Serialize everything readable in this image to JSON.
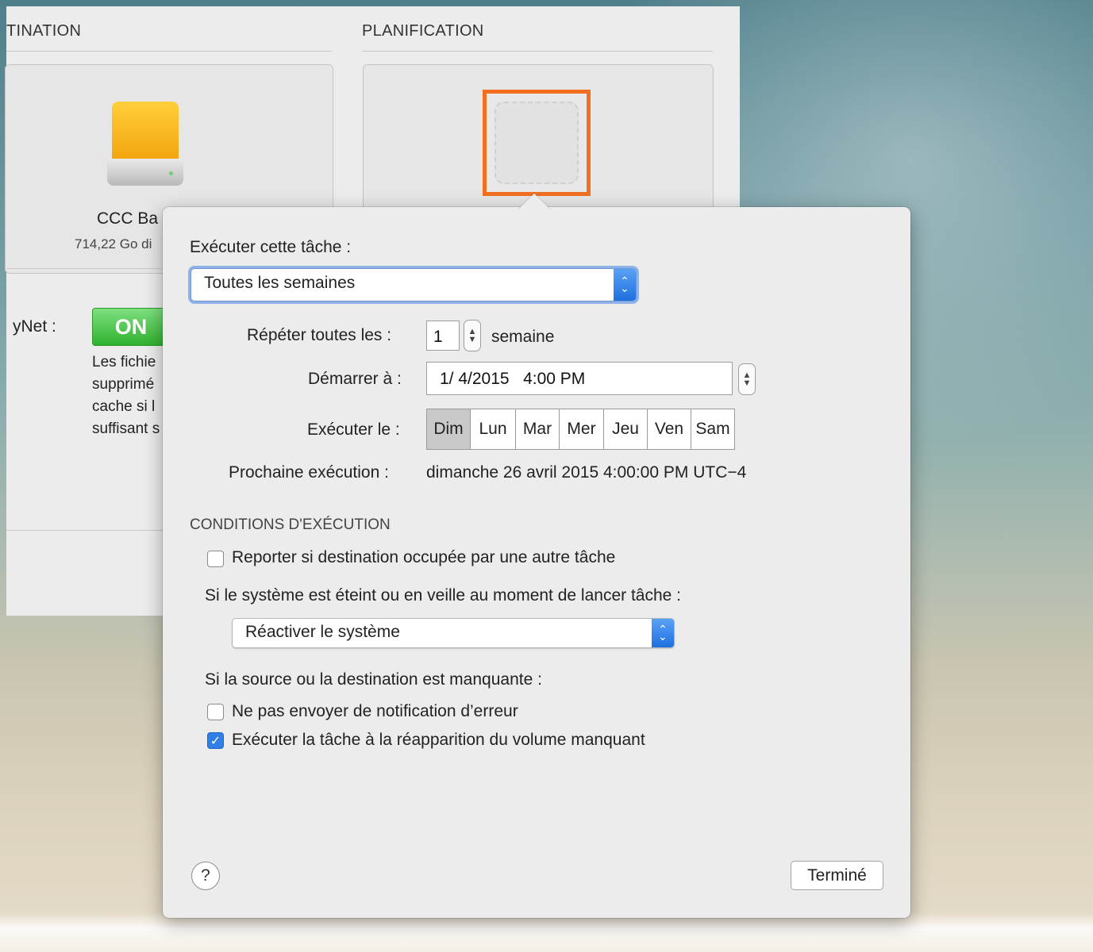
{
  "background": {
    "left_sections": {
      "destination_header": "TINATION",
      "planning_header": "PLANIFICATION"
    },
    "drive": {
      "name": "CCC Ba",
      "size": "714,22 Go di"
    },
    "safetynet": {
      "label": "yNet :",
      "toggle": "ON",
      "text_lines": [
        "Les fichie",
        "supprimé",
        "cache si l",
        "suffisant s"
      ]
    }
  },
  "popover": {
    "run_task_label": "Exécuter cette tâche :",
    "frequency_value": "Toutes les semaines",
    "repeat_label": "Répéter toutes les :",
    "repeat_value": "1",
    "repeat_unit": "semaine",
    "start_label": "Démarrer à :",
    "start_value": "1/ 4/2015   4:00 PM",
    "run_on_label": "Exécuter le :",
    "days": [
      "Dim",
      "Lun",
      "Mar",
      "Mer",
      "Jeu",
      "Ven",
      "Sam"
    ],
    "selected_day": "Dim",
    "next_run_label": "Prochaine exécution :",
    "next_run_value": "dimanche 26 avril 2015 4:00:00 PM UTC−4",
    "conditions_header": "CONDITIONS D'EXÉCUTION",
    "defer_checkbox_label": "Reporter si destination occupée par une autre tâche",
    "defer_checked": false,
    "system_off_label": "Si le système est éteint ou en veille au moment de lancer tâche :",
    "system_off_value": "Réactiver le système",
    "missing_label": "Si la source ou la destination est manquante :",
    "no_notify_label": "Ne pas envoyer de notification d’erreur",
    "no_notify_checked": false,
    "run_on_reappear_label": "Exécuter la tâche à la réapparition du volume manquant",
    "run_on_reappear_checked": true,
    "help_glyph": "?",
    "done_button": "Terminé"
  },
  "colors": {
    "highlight_border": "#f26f21",
    "toggle_on": "#2fb12f",
    "popup_accent": "#1f6fe0"
  }
}
